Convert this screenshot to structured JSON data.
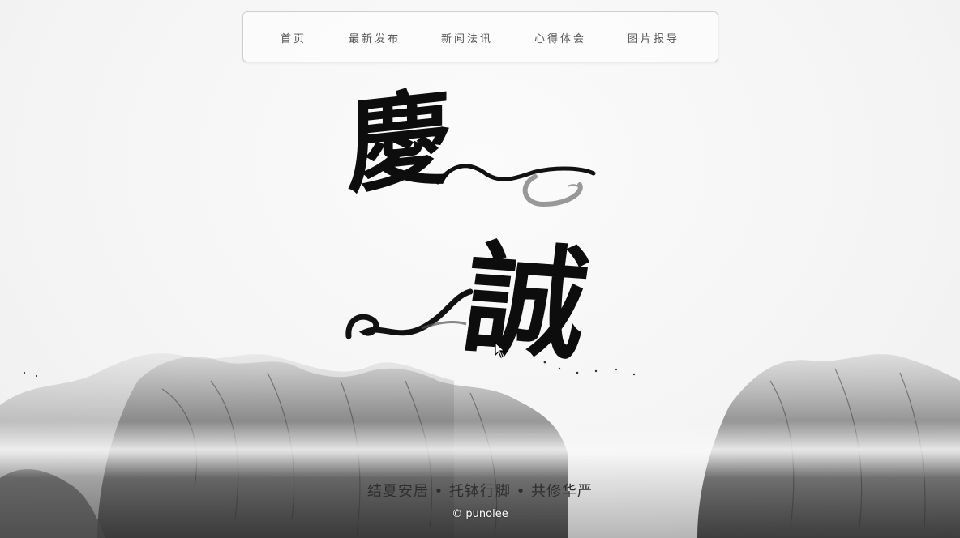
{
  "nav": {
    "items": [
      {
        "label": "首页"
      },
      {
        "label": "最新发布"
      },
      {
        "label": "新闻法讯"
      },
      {
        "label": "心得体会"
      },
      {
        "label": "图片报导"
      }
    ]
  },
  "hero": {
    "glyph_top": "慶",
    "glyph_bottom": "誠"
  },
  "footer": {
    "tagline": "结夏安居 • 托钵行脚 • 共修华严",
    "copyright": "© punolee"
  },
  "colors": {
    "ink": "#0d0d0d",
    "nav_border": "#cfcfcf",
    "nav_text": "#555555",
    "mountain_dark": "#5a5a5a",
    "mountain_light": "#bdbdbd"
  }
}
